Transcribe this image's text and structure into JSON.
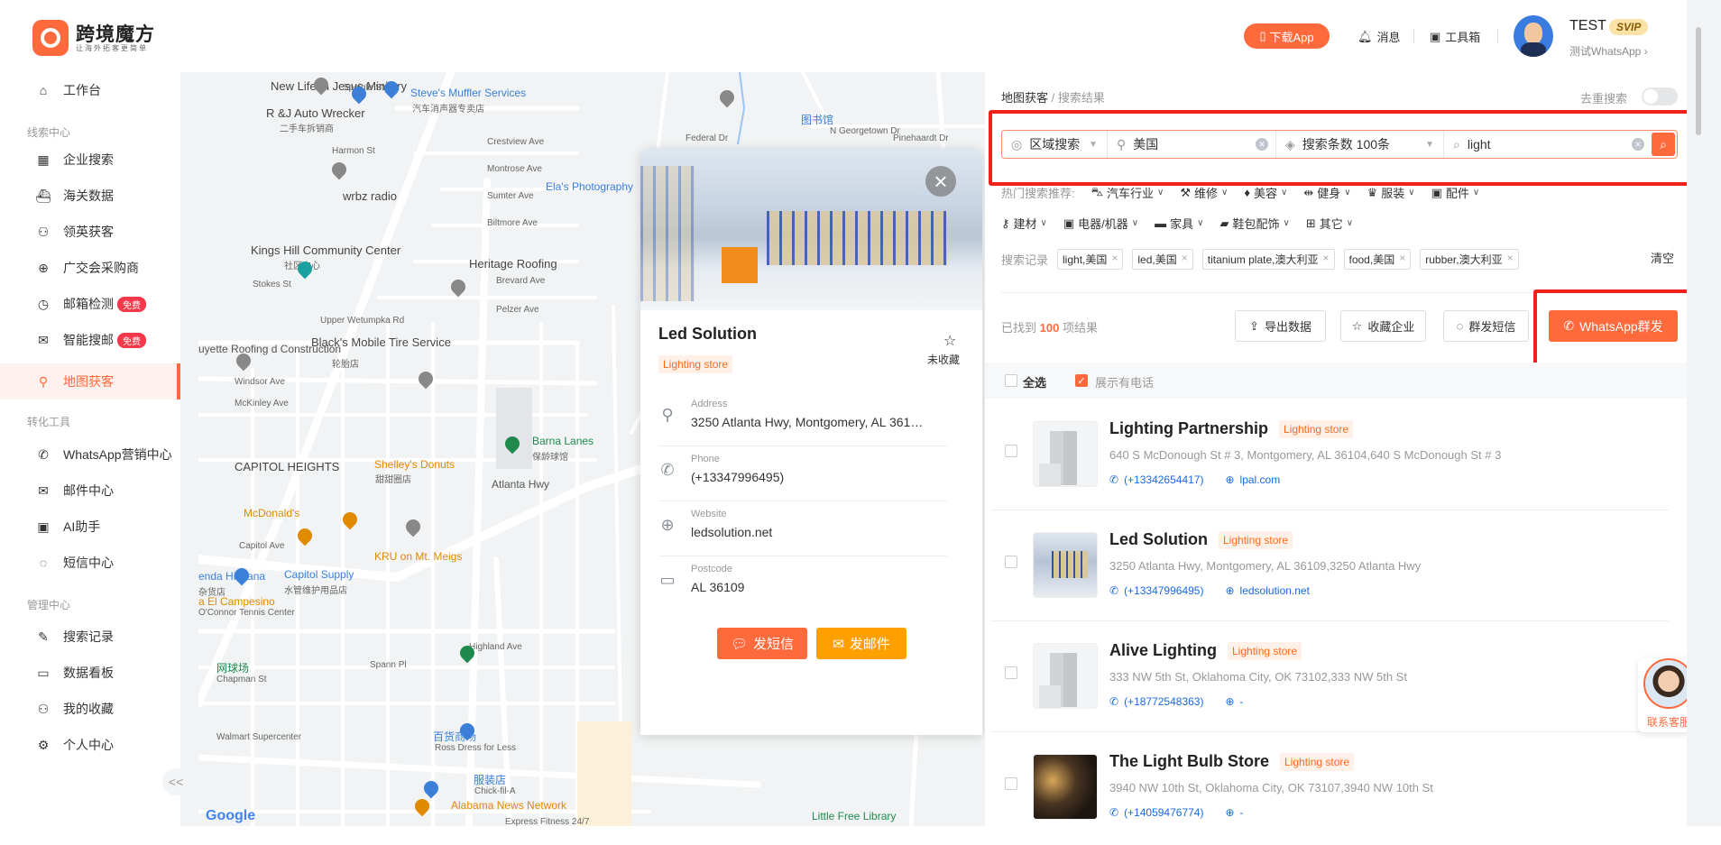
{
  "header": {
    "brand": "跨境魔方",
    "brand_sub": "让海外拓客更简单",
    "download_app": "下载App",
    "messages": "消息",
    "toolbox": "工具箱",
    "user_name": "TEST",
    "user_badge": "SVIP",
    "user_sub": "测试WhatsApp"
  },
  "sidebar": {
    "workbench": "工作台",
    "groups": [
      "线索中心",
      "转化工具",
      "管理中心"
    ],
    "items": [
      {
        "label": "企业搜索",
        "icon": "building-icon"
      },
      {
        "label": "海关数据",
        "icon": "ship-icon"
      },
      {
        "label": "领英获客",
        "icon": "user-search-icon"
      },
      {
        "label": "广交会采购商",
        "icon": "globe-icon"
      },
      {
        "label": "邮箱检测",
        "icon": "gauge-icon",
        "badge": "免费"
      },
      {
        "label": "智能搜邮",
        "icon": "mail-search-icon",
        "badge": "免费"
      },
      {
        "label": "地图获客",
        "icon": "map-icon",
        "active": true
      },
      {
        "label": "WhatsApp营销中心",
        "icon": "whatsapp-icon"
      },
      {
        "label": "邮件中心",
        "icon": "mail-icon"
      },
      {
        "label": "AI助手",
        "icon": "robot-icon"
      },
      {
        "label": "短信中心",
        "icon": "chat-icon"
      },
      {
        "label": "搜索记录",
        "icon": "edit-icon"
      },
      {
        "label": "数据看板",
        "icon": "dashboard-icon"
      },
      {
        "label": "我的收藏",
        "icon": "user-star-icon"
      },
      {
        "label": "个人中心",
        "icon": "gear-icon"
      }
    ],
    "collapse": "<<"
  },
  "map": {
    "labels": [
      "New Life In Jesus Ministry",
      "Speigle St",
      "Steve's Muffler Services",
      "汽车消声器专卖店",
      "R &J Auto Wrecker",
      "二手车拆销商",
      "Harmon St",
      "Crestview Ave",
      "Montrose Ave",
      "Sumter Ave",
      "Ela's Photography",
      "wrbz radio",
      "Biltmore Ave",
      "Kings Hill Community Center",
      "社区中心",
      "Heritage Roofing",
      "Stokes St",
      "Upper Wetumpka Rd",
      "Brevard Ave",
      "Pelzer Ave",
      "Black's Mobile Tire Service",
      "轮胎店",
      "uyette Roofing d Construction",
      "Windsor Ave",
      "McKinley Ave",
      "CAPITOL HEIGHTS",
      "Barna Lanes",
      "保龄球馆",
      "Shelley's Donuts",
      "甜甜圈店",
      "Atlanta Hwy",
      "McDonald's",
      "KRU on Mt. Meigs",
      "Capitol Ave",
      "Capitol Supply",
      "水管维护用品店",
      "enda Hispana",
      "杂货店",
      "a El Campesino",
      "O'Connor Tennis Center",
      "网球场",
      "Chapman St",
      "Spann Pl",
      "Highland Ave",
      "Walmart Supercenter",
      "百货商场",
      "Ross Dress for Less",
      "服装店",
      "Chick-fil-A",
      "Alabama News Network",
      "Express Fitness 24/7",
      "Little Free Library",
      "图书馆",
      "N Georgetown Dr",
      "Pinehaardt Dr",
      "Federal Dr",
      "Google"
    ]
  },
  "popup": {
    "close": "×",
    "title": "Led Solution",
    "tag": "Lighting store",
    "fav_label": "未收藏",
    "rows": [
      {
        "key": "Address",
        "value": "3250 Atlanta Hwy, Montgomery, AL 361…"
      },
      {
        "key": "Phone",
        "value": "(+13347996495)"
      },
      {
        "key": "Website",
        "value": "ledsolution.net"
      },
      {
        "key": "Postcode",
        "value": "AL 36109"
      }
    ],
    "sms_button": "发短信",
    "email_button": "发邮件"
  },
  "panel": {
    "breadcrumb": "地图获客",
    "breadcrumb_sub": "/ 搜索结果",
    "dedup_label": "去重搜索",
    "dedup_on": false,
    "search": {
      "mode": "区域搜索",
      "region": "美国",
      "count": "搜索条数 100条",
      "keyword": "light"
    },
    "hot_label": "热门搜索推荐:",
    "hot_row1": [
      "汽车行业",
      "维修",
      "美容",
      "健身",
      "服装",
      "配件"
    ],
    "hot_row2": [
      "建材",
      "电器/机器",
      "家具",
      "鞋包配饰",
      "其它"
    ],
    "history_label": "搜索记录",
    "history": [
      "light,美国",
      "led,美国",
      "titanium plate,澳大利亚",
      "food,美国",
      "rubber,澳大利亚"
    ],
    "clear": "清空",
    "found_prefix": "已找到",
    "found_count": "100",
    "found_suffix": "项结果",
    "export": "导出数据",
    "favorite": "收藏企业",
    "bulk_sms": "群发短信",
    "whatsapp_bulk": "WhatsApp群发",
    "select_all": "全选",
    "show_phone": "展示有电话",
    "show_phone_checked": true,
    "results": [
      {
        "name": "Lighting Partnership",
        "tag": "Lighting store",
        "address": "640 S McDonough St # 3, Montgomery, AL 36104,640 S McDonough St # 3",
        "phone": "(+13342654417)",
        "website": "lpal.com"
      },
      {
        "name": "Led Solution",
        "tag": "Lighting store",
        "address": "3250 Atlanta Hwy, Montgomery, AL 36109,3250 Atlanta Hwy",
        "phone": "(+13347996495)",
        "website": "ledsolution.net"
      },
      {
        "name": "Alive Lighting",
        "tag": "Lighting store",
        "address": "333 NW 5th St, Oklahoma City, OK 73102,333 NW 5th St",
        "phone": "(+18772548363)",
        "website": "-"
      },
      {
        "name": "The Light Bulb Store",
        "tag": "Lighting store",
        "address": "3940 NW 10th St, Oklahoma City, OK 73107,3940 NW 10th St",
        "phone": "(+14059476774)",
        "website": "-"
      }
    ],
    "customer_service": "联系客服"
  },
  "colors": {
    "accent": "#ff6a3d",
    "highlight_box": "#f0201a",
    "link": "#1a6ae0",
    "free_badge": "#f5384a",
    "email_button": "#ff9f00"
  }
}
